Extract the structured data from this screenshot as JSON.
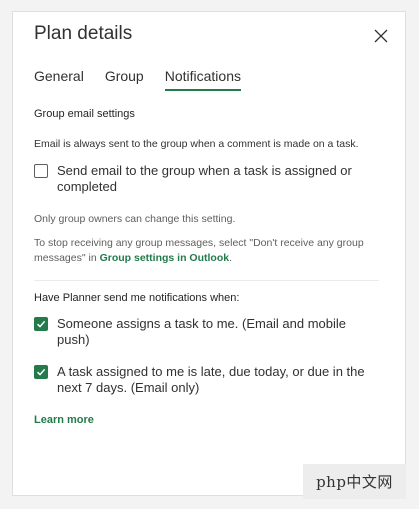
{
  "dialog": {
    "title": "Plan details",
    "close_icon": "close-icon"
  },
  "tabs": [
    {
      "label": "General",
      "active": false
    },
    {
      "label": "Group",
      "active": false
    },
    {
      "label": "Notifications",
      "active": true
    }
  ],
  "group_email": {
    "heading": "Group email settings",
    "note": "Email is always sent to the group when a comment is made on a task.",
    "checkbox_label": "Send email to the group when a task is assigned or completed",
    "checkbox_checked": false,
    "owners_note": "Only group owners can change this setting.",
    "stop_note_prefix": "To stop receiving any group messages, select \"Don't receive any group messages\" in ",
    "stop_note_link": "Group settings in Outlook",
    "stop_note_suffix": "."
  },
  "planner_notifications": {
    "heading": "Have Planner send me notifications when:",
    "options": [
      {
        "label": "Someone assigns a task to me. (Email and mobile push)",
        "checked": true
      },
      {
        "label": "A task assigned to me is late, due today, or due in the next 7 days. (Email only)",
        "checked": true
      }
    ],
    "learn_more": "Learn more"
  },
  "watermark": "php中文网",
  "colors": {
    "accent": "#237b4b",
    "text": "#323130",
    "muted": "#605e5c"
  }
}
